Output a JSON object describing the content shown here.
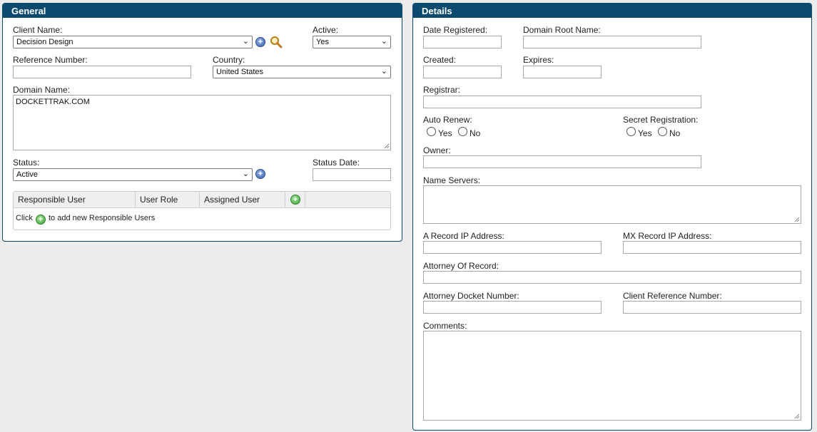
{
  "general": {
    "title": "General",
    "client_name_label": "Client Name:",
    "client_name_value": "Decision Design",
    "active_label": "Active:",
    "active_value": "Yes",
    "reference_number_label": "Reference Number:",
    "reference_number_value": "",
    "country_label": "Country:",
    "country_value": "United States",
    "domain_name_label": "Domain Name:",
    "domain_name_value": "DOCKETTRAK.COM",
    "status_label": "Status:",
    "status_value": "Active",
    "status_date_label": "Status Date:",
    "status_date_value": "",
    "users_table": {
      "columns": [
        "Responsible User",
        "User Role",
        "Assigned User"
      ],
      "empty_prefix": "Click",
      "empty_suffix": "to add new Responsible Users"
    }
  },
  "details": {
    "title": "Details",
    "date_registered_label": "Date Registered:",
    "domain_root_name_label": "Domain Root Name:",
    "created_label": "Created:",
    "expires_label": "Expires:",
    "registrar_label": "Registrar:",
    "auto_renew_label": "Auto Renew:",
    "secret_registration_label": "Secret Registration:",
    "yes_label": "Yes",
    "no_label": "No",
    "owner_label": "Owner:",
    "name_servers_label": "Name Servers:",
    "a_record_label": "A Record IP Address:",
    "mx_record_label": "MX Record IP Address:",
    "attorney_of_record_label": "Attorney Of Record:",
    "attorney_docket_label": "Attorney Docket Number:",
    "client_reference_label": "Client Reference Number:",
    "comments_label": "Comments:"
  },
  "icons": {
    "add": "plus-circle-icon",
    "search": "magnifier-icon",
    "dropdown": "chevron-down-icon"
  },
  "colors": {
    "header": "#0b4a6e",
    "background": "#ececec"
  }
}
